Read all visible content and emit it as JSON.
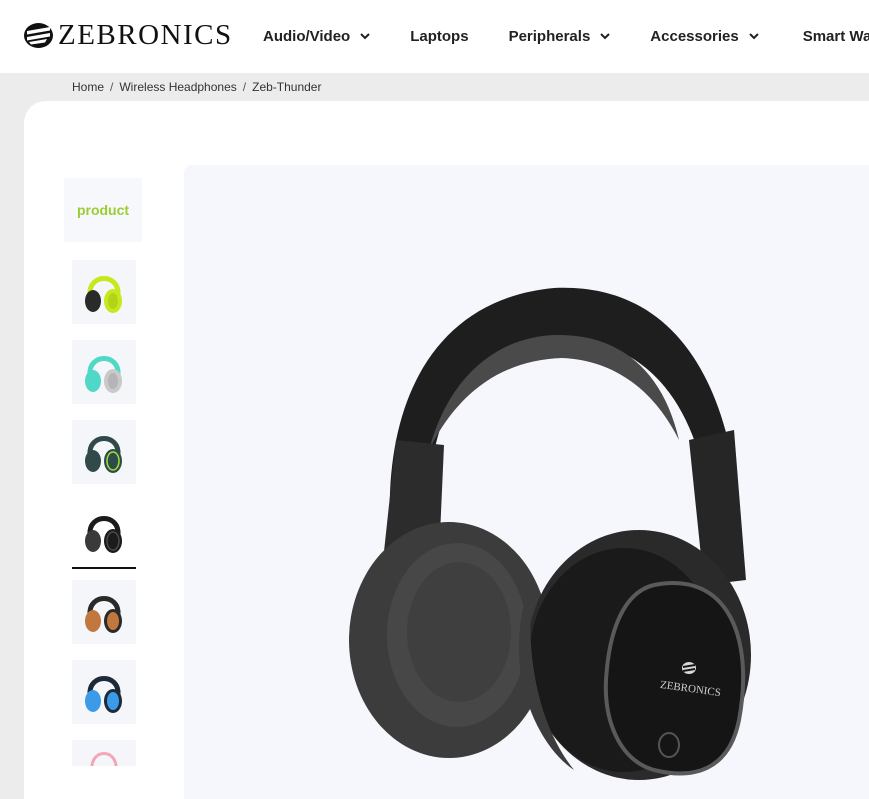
{
  "brand": {
    "name": "ZEBRONICS"
  },
  "nav": {
    "items": [
      {
        "label": "Audio/Video",
        "has_dropdown": true
      },
      {
        "label": "Laptops",
        "has_dropdown": false
      },
      {
        "label": "Peripherals",
        "has_dropdown": true
      },
      {
        "label": "Accessories",
        "has_dropdown": true
      },
      {
        "label": "Smart Watch",
        "has_dropdown": false
      }
    ]
  },
  "breadcrumb": {
    "items": [
      "Home",
      "Wireless Headphones",
      "Zeb-Thunder"
    ],
    "separator": "/"
  },
  "gallery": {
    "label_tile": "product",
    "thumbnails": [
      {
        "color_name": "neon yellow",
        "accent": "#c8e81e",
        "body": "#2a2a2a"
      },
      {
        "color_name": "teal grey",
        "accent": "#4fd8c8",
        "body": "#c9c9c9"
      },
      {
        "color_name": "dark teal",
        "accent": "#9be23a",
        "body": "#2f4a48"
      },
      {
        "color_name": "black",
        "accent": "#3a3a3a",
        "body": "#1b1b1b",
        "selected": true
      },
      {
        "color_name": "brown",
        "accent": "#c2773e",
        "body": "#2a2a2a"
      },
      {
        "color_name": "blue",
        "accent": "#3b9be8",
        "body": "#1e2a3a"
      },
      {
        "color_name": "pink",
        "accent": "#f2a8b8",
        "body": "#e9e9e9"
      }
    ],
    "main_image": {
      "product": "Zeb-Thunder",
      "color": "black",
      "logo_text": "ZEBRONICS"
    }
  },
  "colors": {
    "label_green": "#9acd32",
    "page_bg": "#ececec",
    "image_bg": "#f6f7fc"
  }
}
